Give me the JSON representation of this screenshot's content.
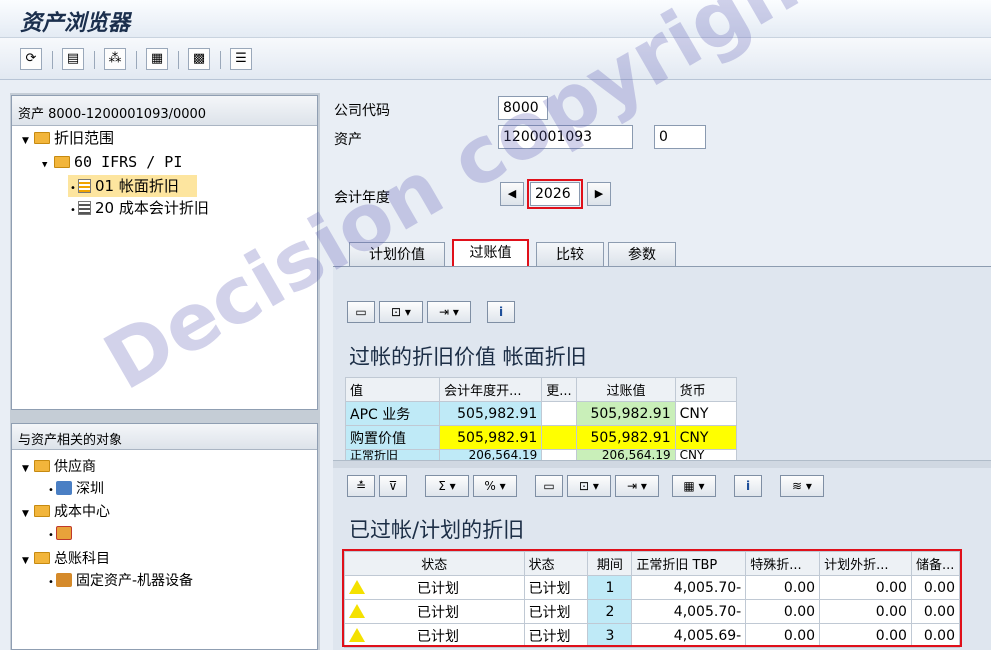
{
  "window": {
    "title": "资产浏览器"
  },
  "toolbar": {
    "buttons": [
      {
        "icon": "refresh-icon",
        "glyph": "⟳"
      },
      {
        "icon": "save-icon",
        "glyph": "▤"
      },
      {
        "icon": "find-icon",
        "glyph": "⁂"
      },
      {
        "icon": "layout-icon",
        "glyph": "▦"
      },
      {
        "icon": "grid-icon",
        "glyph": "▩"
      },
      {
        "icon": "list-icon",
        "glyph": "☰"
      }
    ]
  },
  "tree": {
    "header": "资产 8000-1200001093/0000",
    "root": "折旧范围",
    "group": "60 IFRS / PI",
    "items": [
      {
        "label": "01 帐面折旧",
        "selected": true
      },
      {
        "label": "20 成本会计折旧",
        "selected": false
      }
    ]
  },
  "related": {
    "header": "与资产相关的对象",
    "nodes": [
      {
        "label": "供应商",
        "child": "深圳"
      },
      {
        "label": "成本中心",
        "child": ""
      },
      {
        "label": "总账科目",
        "child": "固定资产-机器设备"
      }
    ]
  },
  "form": {
    "company_label": "公司代码",
    "company_value": "8000",
    "asset_label": "资产",
    "asset_value": "1200001093",
    "subasset_value": "0",
    "fy_label": "会计年度",
    "fy_value": "2026"
  },
  "tabs": [
    "计划价值",
    "过账值",
    "比较",
    "参数"
  ],
  "upper": {
    "title": "过帐的折旧价值 帐面折旧",
    "headers": [
      "值",
      "会计年度开...",
      "更...",
      "过账值",
      "货币"
    ],
    "rows": [
      [
        "APC 业务",
        "505,982.91",
        "",
        "505,982.91",
        "CNY"
      ],
      [
        "购置价值",
        "505,982.91",
        "",
        "505,982.91",
        "CNY"
      ],
      [
        "正常折旧",
        "206,564.19",
        "",
        "206,564.19",
        "CNY"
      ]
    ]
  },
  "lower": {
    "title": "已过帐/计划的折旧",
    "headers": [
      "状态",
      "状态",
      "期间",
      "正常折旧 TBP",
      "特殊折...",
      "计划外折...",
      "储备..."
    ],
    "rows": [
      [
        "已计划",
        "已计划",
        "1",
        "4,005.70-",
        "0.00",
        "0.00",
        "0.00"
      ],
      [
        "已计划",
        "已计划",
        "2",
        "4,005.70-",
        "0.00",
        "0.00",
        "0.00"
      ],
      [
        "已计划",
        "已计划",
        "3",
        "4,005.69-",
        "0.00",
        "0.00",
        "0.00"
      ]
    ]
  },
  "watermark": "Decision copyright"
}
